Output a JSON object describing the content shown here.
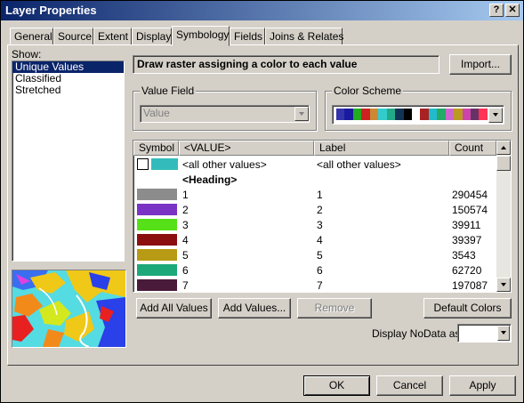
{
  "window": {
    "title": "Layer Properties",
    "help_btn": "?",
    "close_btn": "✕"
  },
  "tabs": [
    {
      "label": "General"
    },
    {
      "label": "Source"
    },
    {
      "label": "Extent"
    },
    {
      "label": "Display"
    },
    {
      "label": "Symbology"
    },
    {
      "label": "Fields"
    },
    {
      "label": "Joins & Relates"
    }
  ],
  "show": {
    "label": "Show:",
    "items": [
      "Unique Values",
      "Classified",
      "Stretched"
    ]
  },
  "description": "Draw raster assigning a color to each value",
  "import_btn": "Import...",
  "value_field": {
    "label": "Value Field",
    "value": "Value"
  },
  "color_scheme": {
    "label": "Color Scheme",
    "colors": [
      "#3333aa",
      "#1a1aa0",
      "#22aa22",
      "#cc2222",
      "#cc8833",
      "#33cccc",
      "#22aa88",
      "#113355",
      "#000000",
      "#ffffff",
      "#aa2222",
      "#22bbcc",
      "#22aa66",
      "#cc66cc",
      "#bb9922",
      "#cc44aa",
      "#663366",
      "#ff3355"
    ]
  },
  "table": {
    "headers": [
      "Symbol",
      "<VALUE>",
      "Label",
      "Count"
    ],
    "other": {
      "value": "<all other values>",
      "label": "<all other values>",
      "color": "#33bbbb"
    },
    "heading": "<Heading>",
    "rows": [
      {
        "value": "1",
        "label": "1",
        "count": "290454",
        "color": "#8c8c8c"
      },
      {
        "value": "2",
        "label": "2",
        "count": "150574",
        "color": "#7a33c4"
      },
      {
        "value": "3",
        "label": "3",
        "count": "39911",
        "color": "#55e018"
      },
      {
        "value": "4",
        "label": "4",
        "count": "39397",
        "color": "#8c0f0f"
      },
      {
        "value": "5",
        "label": "5",
        "count": "3543",
        "color": "#b89a14"
      },
      {
        "value": "6",
        "label": "6",
        "count": "62720",
        "color": "#1ca879"
      },
      {
        "value": "7",
        "label": "7",
        "count": "197087",
        "color": "#4a1a3a"
      }
    ]
  },
  "buttons": {
    "add_all": "Add All Values",
    "add_values": "Add Values...",
    "remove": "Remove",
    "default_colors": "Default Colors"
  },
  "nodata": {
    "label": "Display NoData as"
  },
  "dialog": {
    "ok": "OK",
    "cancel": "Cancel",
    "apply": "Apply"
  }
}
